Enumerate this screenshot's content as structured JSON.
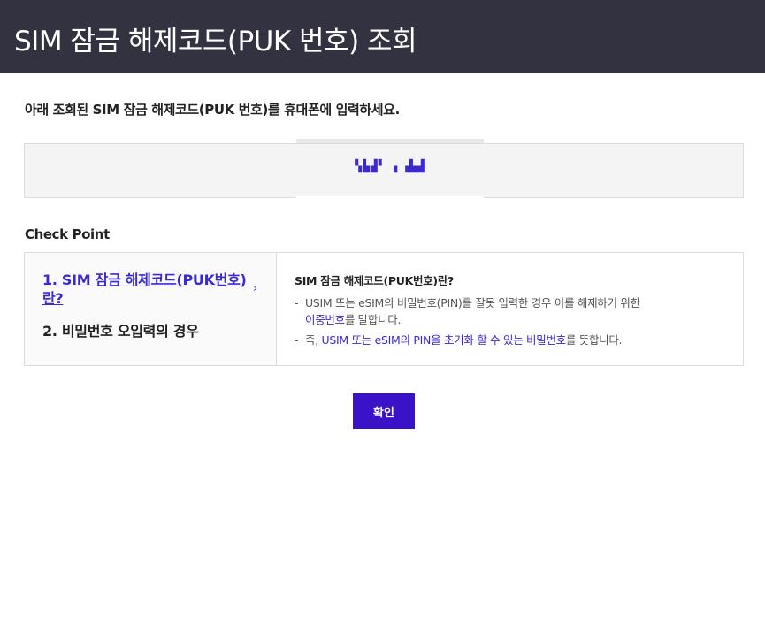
{
  "header": {
    "title": "SIM 잠금 해제코드(PUK 번호) 조회"
  },
  "instruction": "아래 조회된 SIM 잠금 해제코드(PUK 번호)를 휴대폰에 입력하세요.",
  "code": {
    "value": "▚▙▟▘ ▖▗▙▟"
  },
  "checkpoint": {
    "title": "Check Point",
    "nav": [
      {
        "label": "1. SIM 잠금 해제코드(PUK번호)란?"
      },
      {
        "label": "2. 비밀번호 오입력의 경우"
      }
    ],
    "detail": {
      "title": "SIM 잠금 해제코드(PUK번호)란?",
      "bullet1_line1": "USIM 또는 eSIM의 비밀번호(PIN)를 잘못 입력한 경우 이를 해제하기 위한",
      "bullet1_hl": "이중번호",
      "bullet1_tail": "를 말합니다.",
      "bullet2_prefix": "즉, ",
      "bullet2_hl": "USIM 또는 eSIM의 PIN을 초기화 할 수 있는 비밀번호",
      "bullet2_tail": "를 뜻합니다."
    }
  },
  "confirm_label": "확인",
  "icons": {
    "chevron": "chevron-right-icon"
  },
  "colors": {
    "header_bg": "#333240",
    "accent": "#3a2ad0",
    "button_bg": "#3a12c8"
  }
}
